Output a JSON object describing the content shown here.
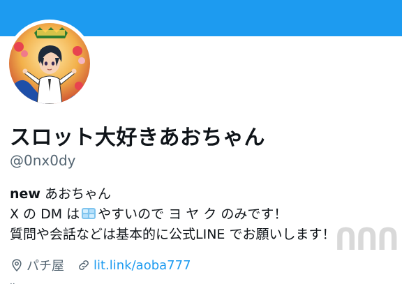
{
  "profile": {
    "display_name": "スロット大好きあおちゃん",
    "handle": "@0nx0dy",
    "bio": {
      "line1_tag": "new",
      "line1_text": " あおちゃん",
      "line2_before": "X の DM は",
      "line2_emoji_icon": "ice-cube-icon",
      "line2_after": "やすいので ヨ ヤ ク のみです！",
      "line3": "質問や会話などは基本的に公式LINE でお願いします！"
    },
    "location": "パチ屋",
    "link": "lit.link/aoba777"
  },
  "colors": {
    "banner": "#1d9bf0",
    "link": "#1d9bf0",
    "secondary_text": "#536471"
  },
  "watermark": "ՈՈՈ"
}
